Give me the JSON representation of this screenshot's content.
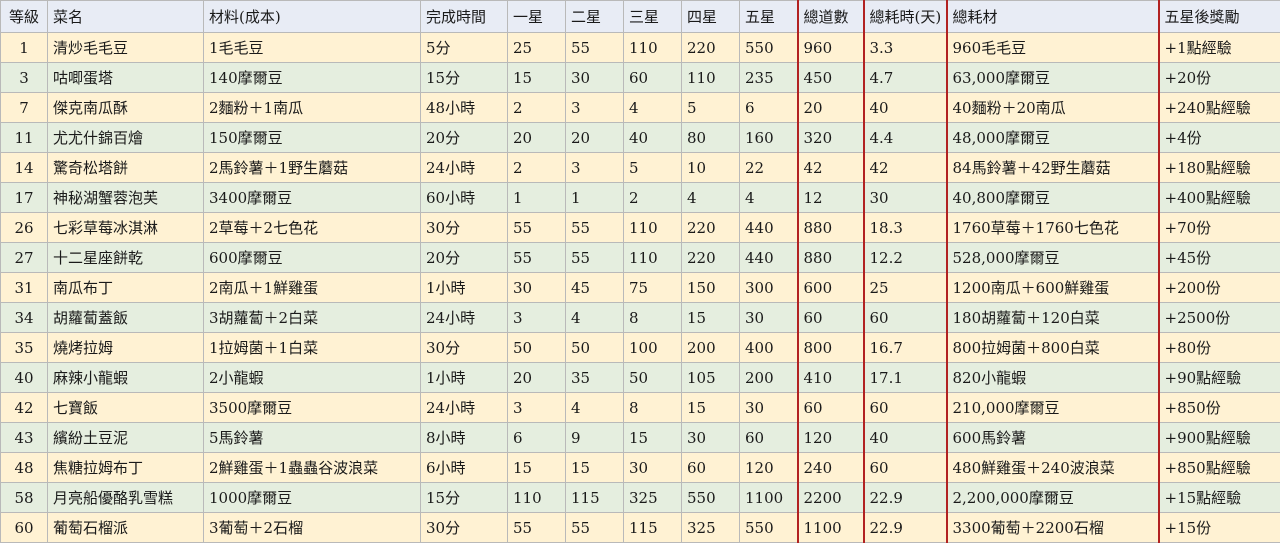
{
  "headers": [
    "等級",
    "菜名",
    "材料(成本)",
    "完成時間",
    "一星",
    "二星",
    "三星",
    "四星",
    "五星",
    "總道數",
    "總耗時(天)",
    "總耗材",
    "五星後獎勵"
  ],
  "rows": [
    [
      "1",
      "清炒毛毛豆",
      "1毛毛豆",
      "5分",
      "25",
      "55",
      "110",
      "220",
      "550",
      "960",
      "3.3",
      "960毛毛豆",
      "+1點經驗"
    ],
    [
      "3",
      "咕唧蛋塔",
      "140摩爾豆",
      "15分",
      "15",
      "30",
      "60",
      "110",
      "235",
      "450",
      "4.7",
      "63,000摩爾豆",
      "+20份"
    ],
    [
      "7",
      "傑克南瓜酥",
      "2麵粉＋1南瓜",
      "48小時",
      "2",
      "3",
      "4",
      "5",
      "6",
      "20",
      "40",
      "40麵粉＋20南瓜",
      "+240點經驗"
    ],
    [
      "11",
      "尤尤什錦百燴",
      "150摩爾豆",
      "20分",
      "20",
      "20",
      "40",
      "80",
      "160",
      "320",
      "4.4",
      "48,000摩爾豆",
      "+4份"
    ],
    [
      "14",
      "驚奇松塔餅",
      "2馬鈴薯＋1野生蘑菇",
      "24小時",
      "2",
      "3",
      "5",
      "10",
      "22",
      "42",
      "42",
      "84馬鈴薯＋42野生蘑菇",
      "+180點經驗"
    ],
    [
      "17",
      "神秘湖蟹蓉泡芙",
      "3400摩爾豆",
      "60小時",
      "1",
      "1",
      "2",
      "4",
      "4",
      "12",
      "30",
      "40,800摩爾豆",
      "+400點經驗"
    ],
    [
      "26",
      "七彩草莓冰淇淋",
      "2草莓＋2七色花",
      "30分",
      "55",
      "55",
      "110",
      "220",
      "440",
      "880",
      "18.3",
      "1760草莓＋1760七色花",
      "+70份"
    ],
    [
      "27",
      "十二星座餅乾",
      "600摩爾豆",
      "20分",
      "55",
      "55",
      "110",
      "220",
      "440",
      "880",
      "12.2",
      "528,000摩爾豆",
      "+45份"
    ],
    [
      "31",
      "南瓜布丁",
      "2南瓜＋1鮮雞蛋",
      "1小時",
      "30",
      "45",
      "75",
      "150",
      "300",
      "600",
      "25",
      "1200南瓜＋600鮮雞蛋",
      "+200份"
    ],
    [
      "34",
      "胡蘿蔔蓋飯",
      "3胡蘿蔔＋2白菜",
      "24小時",
      "3",
      "4",
      "8",
      "15",
      "30",
      "60",
      "60",
      "180胡蘿蔔＋120白菜",
      "+2500份"
    ],
    [
      "35",
      "燒烤拉姆",
      "1拉姆菌＋1白菜",
      "30分",
      "50",
      "50",
      "100",
      "200",
      "400",
      "800",
      "16.7",
      "800拉姆菌＋800白菜",
      "+80份"
    ],
    [
      "40",
      "麻辣小龍蝦",
      "2小龍蝦",
      "1小時",
      "20",
      "35",
      "50",
      "105",
      "200",
      "410",
      "17.1",
      "820小龍蝦",
      "+90點經驗"
    ],
    [
      "42",
      "七寶飯",
      "3500摩爾豆",
      "24小時",
      "3",
      "4",
      "8",
      "15",
      "30",
      "60",
      "60",
      "210,000摩爾豆",
      "+850份"
    ],
    [
      "43",
      "繽紛土豆泥",
      "5馬鈴薯",
      "8小時",
      "6",
      "9",
      "15",
      "30",
      "60",
      "120",
      "40",
      "600馬鈴薯",
      "+900點經驗"
    ],
    [
      "48",
      "焦糖拉姆布丁",
      "2鮮雞蛋＋1蟲蟲谷波浪菜",
      "6小時",
      "15",
      "15",
      "30",
      "60",
      "120",
      "240",
      "60",
      "480鮮雞蛋＋240波浪菜",
      "+850點經驗"
    ],
    [
      "58",
      "月亮船優酪乳雪糕",
      "1000摩爾豆",
      "15分",
      "110",
      "115",
      "325",
      "550",
      "1100",
      "2200",
      "22.9",
      "2,200,000摩爾豆",
      "+15點經驗"
    ],
    [
      "60",
      "葡萄石榴派",
      "3葡萄＋2石榴",
      "30分",
      "55",
      "55",
      "115",
      "325",
      "550",
      "1100",
      "22.9",
      "3300葡萄＋2200石榴",
      "+15份"
    ]
  ]
}
